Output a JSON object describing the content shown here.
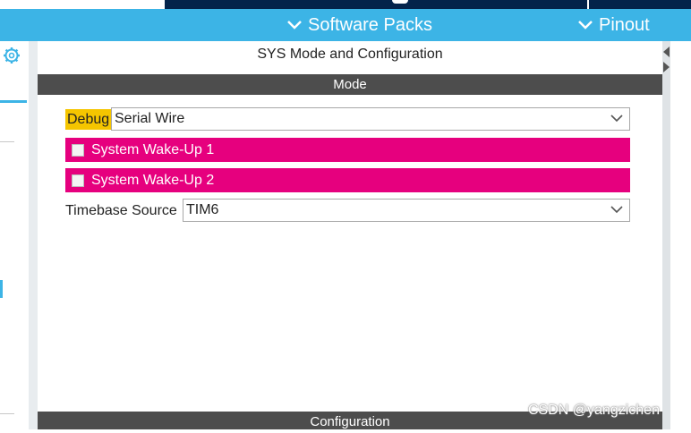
{
  "menubar": {
    "software_packs": "Software Packs",
    "pinout": "Pinout"
  },
  "panel": {
    "title": "SYS Mode and Configuration",
    "mode_header": "Mode",
    "config_header": "Configuration"
  },
  "mode": {
    "debug_label": "Debug",
    "debug_value": "Serial Wire",
    "wakeup1_label": "System Wake-Up 1",
    "wakeup2_label": "System Wake-Up 2",
    "timebase_label": "Timebase Source",
    "timebase_value": "TIM6"
  },
  "watermark": "CSDN @yangzichen",
  "colors": {
    "accent_blue": "#3cb4e6",
    "dark_navy": "#03234b",
    "header_gray": "#4d4d4d",
    "highlight_yellow": "#f5c500",
    "pin_magenta": "#e6007e"
  },
  "icons": [
    "gear-icon",
    "chevron-down-icon",
    "collapse-left-icon",
    "expand-right-icon"
  ]
}
